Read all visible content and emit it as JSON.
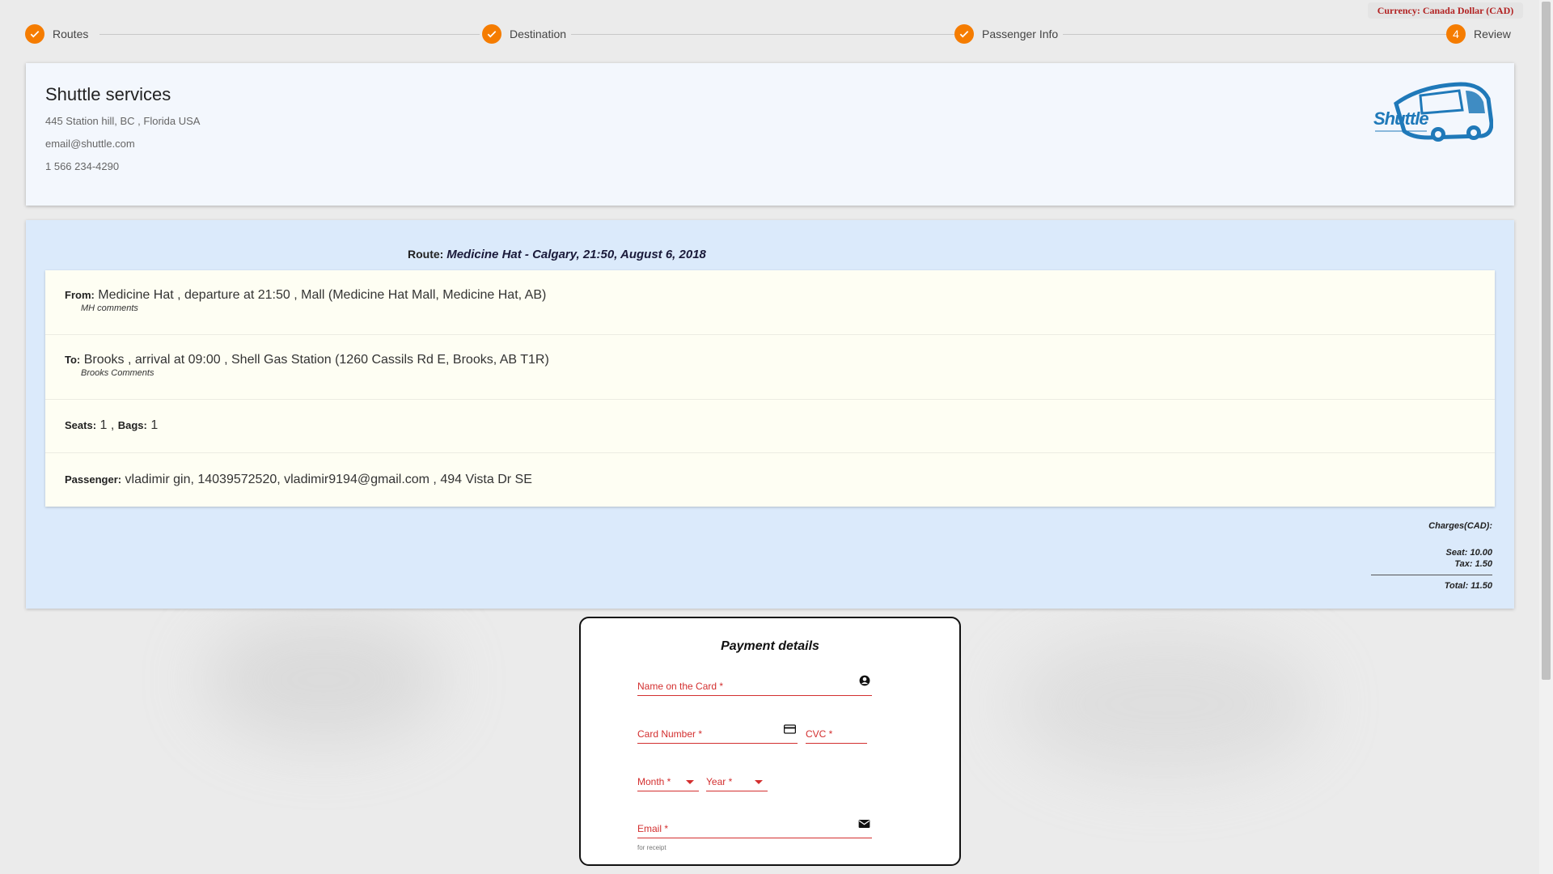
{
  "currency": "Currency: Canada Dollar (CAD)",
  "stepper": {
    "steps": [
      {
        "label": "Routes",
        "state": "done",
        "icon": "check-icon"
      },
      {
        "label": "Destination",
        "state": "done",
        "icon": "check-icon"
      },
      {
        "label": "Passenger Info",
        "state": "done",
        "icon": "check-icon"
      },
      {
        "label": "Review",
        "state": "active",
        "number": "4"
      }
    ],
    "accent": "#f57c00"
  },
  "company": {
    "name": "Shuttle services",
    "address": "445 Station hill, BC , Florida USA",
    "email": "email@shuttle.com",
    "phone": "1 566 234-4290",
    "logo_text": "Shuttle"
  },
  "route": {
    "label": "Route:",
    "value": "Medicine Hat - Calgary, 21:50, August 6, 2018"
  },
  "details": {
    "from_label": "From:",
    "from_value": "Medicine Hat , departure at 21:50 , Mall (Medicine Hat Mall, Medicine Hat, AB)",
    "from_comment": "MH comments",
    "to_label": "To:",
    "to_value": "Brooks , arrival at 09:00 , Shell Gas Station (1260 Cassils Rd E, Brooks, AB T1R)",
    "to_comment": "Brooks Comments",
    "seats_label": "Seats:",
    "seats_value": "1",
    "bags_label": "Bags:",
    "bags_value": "1",
    "passenger_label": "Passenger:",
    "passenger_value": "vladimir gin, 14039572520, vladimir9194@gmail.com , 494 Vista Dr SE"
  },
  "charges": {
    "header": "Charges(CAD):",
    "seat": "Seat: 10.00",
    "tax": "Tax: 1.50",
    "total": "Total: 11.50"
  },
  "payment": {
    "title": "Payment details",
    "name_placeholder": "Name on the Card *",
    "card_placeholder": "Card Number *",
    "cvc_placeholder": "CVC *",
    "month_placeholder": "Month *",
    "year_placeholder": "Year *",
    "email_placeholder": "Email *",
    "email_helper": "for receipt",
    "error_color": "#d32f2f"
  }
}
